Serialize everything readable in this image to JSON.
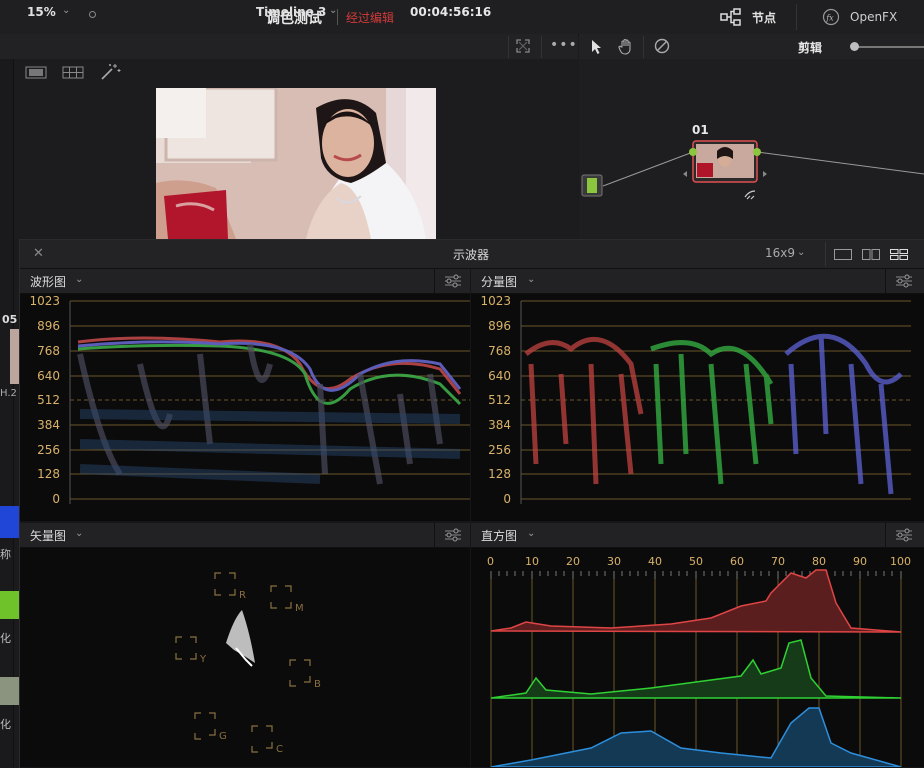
{
  "header": {
    "project_title": "调色测试",
    "project_status": "经过编辑",
    "nodes_label": "节点",
    "openfx_label": "OpenFX"
  },
  "viewer": {
    "zoom": "15%",
    "timeline_name": "Timeline 3",
    "timecode": "00:04:56:16"
  },
  "node_editor": {
    "mode_label": "剪辑",
    "node_number": "01"
  },
  "left_panel": {
    "clip_number": "05",
    "codec_fragment": "H.2",
    "char_1": "称",
    "char_2": "化",
    "char_3": "化"
  },
  "scopes": {
    "title": "示波器",
    "aspect": "16x9",
    "waveform": {
      "label": "波形图",
      "y_ticks": [
        "1023",
        "896",
        "768",
        "640",
        "512",
        "384",
        "256",
        "128",
        "0"
      ]
    },
    "parade": {
      "label": "分量图",
      "y_ticks": [
        "1023",
        "896",
        "768",
        "640",
        "512",
        "384",
        "256",
        "128",
        "0"
      ]
    },
    "vectorscope": {
      "label": "矢量图",
      "targets": [
        "R",
        "M",
        "Y",
        "B",
        "G",
        "C"
      ]
    },
    "histogram": {
      "label": "直方图",
      "x_ticks": [
        "0",
        "10",
        "20",
        "30",
        "40",
        "50",
        "60",
        "70",
        "80",
        "90",
        "100"
      ]
    }
  },
  "colors": {
    "accent_red": "#d23a3a",
    "tick_gold": "#d9b26a",
    "node_green": "#8cc63f"
  }
}
